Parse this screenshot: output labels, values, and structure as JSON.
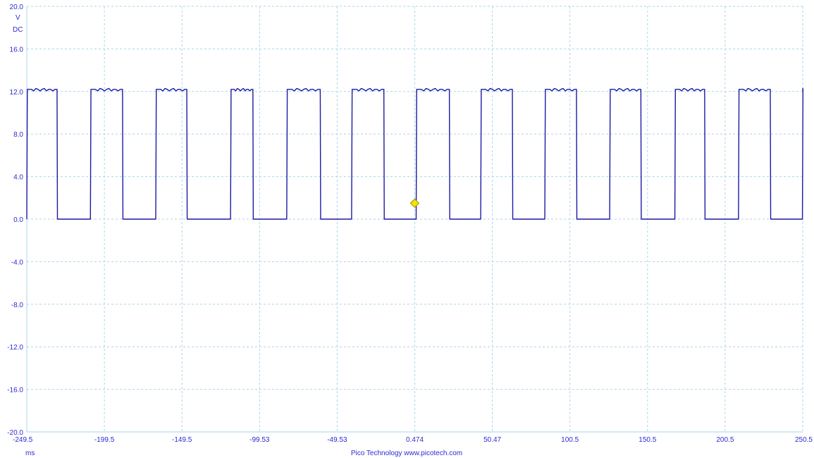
{
  "chart_data": {
    "type": "line",
    "y_unit": "V",
    "y_coupling": "DC",
    "x_unit": "ms",
    "y_range": [
      -20.0,
      20.0
    ],
    "x_range": [
      -249.5,
      250.5
    ],
    "y_tick_labels": [
      "20.0",
      "16.0",
      "12.0",
      "8.0",
      "4.0",
      "0.0",
      "-4.0",
      "-8.0",
      "-12.0",
      "-16.0",
      "-20.0"
    ],
    "x_tick_labels": [
      "-249.5",
      "-199.5",
      "-149.5",
      "-99.53",
      "-49.53",
      "0.474",
      "50.47",
      "100.5",
      "150.5",
      "200.5",
      "250.5"
    ],
    "grid": true,
    "trigger_marker": {
      "x": 0.474,
      "y": 1.5
    },
    "series": [
      {
        "color": "#1a1aa8",
        "signal": "square wave, 0 V to 12.2 V",
        "high_level": 12.2,
        "low_level": 0.0,
        "high_intervals_ms": [
          [
            -249.5,
            -230.0
          ],
          [
            -208.5,
            -187.8
          ],
          [
            -166.4,
            -146.4
          ],
          [
            -118.2,
            -103.8
          ],
          [
            -82.0,
            -60.4
          ],
          [
            -40.2,
            -19.4
          ],
          [
            1.4,
            22.8
          ],
          [
            43.0,
            63.4
          ],
          [
            84.3,
            104.7
          ],
          [
            126.1,
            146.2
          ],
          [
            168.1,
            187.3
          ],
          [
            209.1,
            229.6
          ],
          [
            250.3,
            250.5
          ]
        ]
      }
    ]
  },
  "footer": {
    "credit": "Pico Technology   www.picotech.com"
  },
  "colors": {
    "text": "#2b2bd0",
    "trace": "#1a1aa8",
    "grid": "#a9d6ea",
    "marker_fill": "#f2e600",
    "marker_stroke": "#9a9200"
  }
}
